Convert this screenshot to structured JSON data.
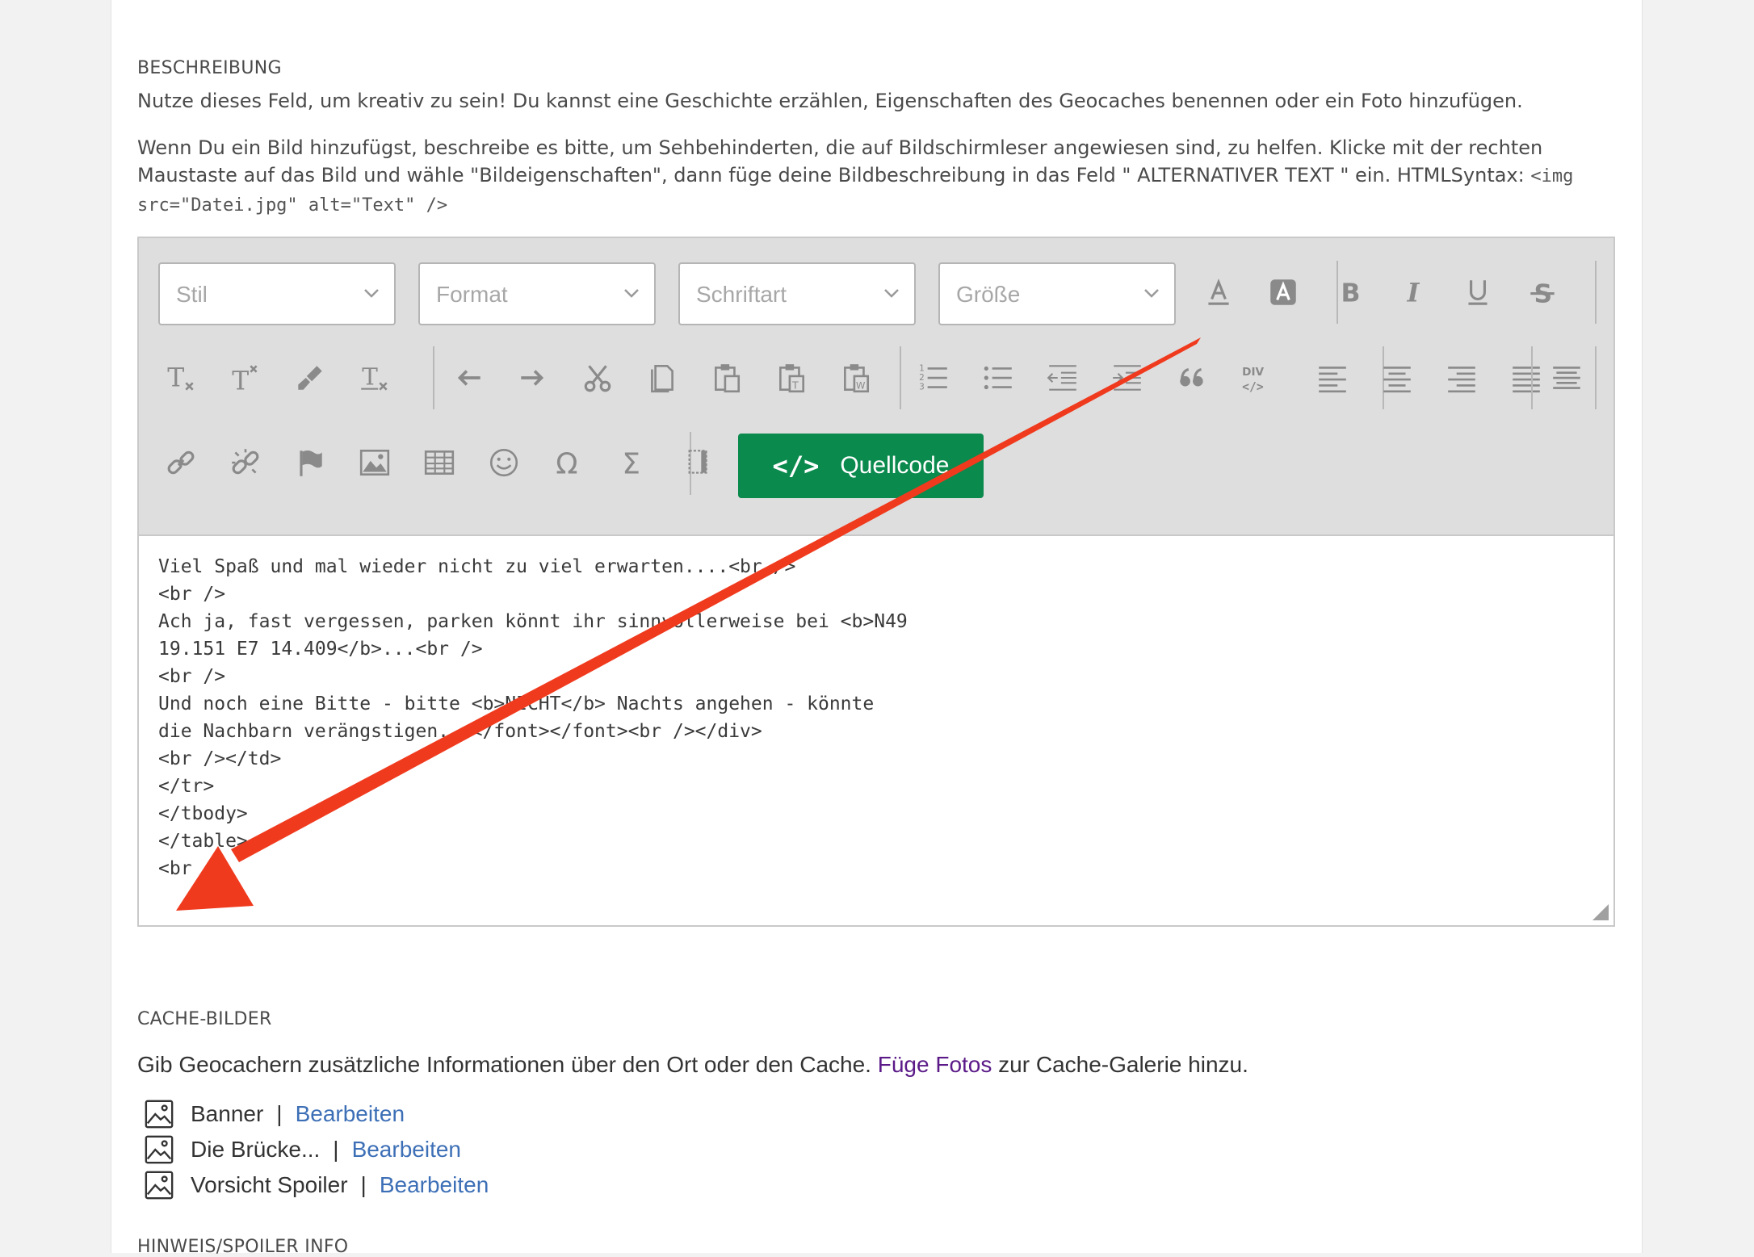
{
  "description_section": {
    "label": "BESCHREIBUNG",
    "intro": "Nutze dieses Feld, um kreativ zu sein! Du kannst eine Geschichte erzählen, Eigenschaften des Geocaches benennen oder ein Foto hinzufügen.",
    "hint_text": "Wenn Du ein Bild hinzufügst, beschreibe es bitte, um Sehbehinderten, die auf Bildschirmleser angewiesen sind, zu helfen. Klicke mit der rechten Maustaste auf das Bild und wähle \"Bildeigenschaften\", dann füge deine Bildbeschreibung in das Feld \" ALTERNATIVER TEXT \" ein. HTMLSyntax: ",
    "hint_code": "<img src=\"Datei.jpg\" alt=\"Text\" />"
  },
  "toolbar": {
    "style_placeholder": "Stil",
    "format_placeholder": "Format",
    "font_placeholder": "Schriftart",
    "size_placeholder": "Größe",
    "source_button_icon": "</>",
    "source_button_label": "Quellcode",
    "source_button_color": "#0a8a4d"
  },
  "editor": {
    "source_lines": [
      "Viel Spaß und mal wieder nicht zu viel erwarten....<br />",
      "<br />",
      "Ach ja, fast vergessen, parken könnt ihr sinnvollerweise bei <b>N49",
      "19.151 E7 14.409</b>...<br />",
      "<br />",
      "Und noch eine Bitte - bitte <b>NICHT</b> Nachts angehen - könnte",
      "die Nachbarn verängstigen...</font></font><br /></div>",
      "<br /></td>",
      "</tr>",
      "</tbody>",
      "</table>",
      "<br />"
    ]
  },
  "cache_images": {
    "label": "CACHE-BILDER",
    "text_before": "Gib Geocachern zusätzliche Informationen über den Ort oder den Cache. ",
    "link_text": "Füge Fotos",
    "text_after": " zur Cache-Galerie hinzu.",
    "separator": "|",
    "items": [
      {
        "name": "Banner",
        "action": "Bearbeiten"
      },
      {
        "name": "Die Brücke...",
        "action": "Bearbeiten"
      },
      {
        "name": "Vorsicht Spoiler",
        "action": "Bearbeiten"
      }
    ]
  },
  "next_section": {
    "label": "HINWEIS/SPOILER INFO"
  },
  "annotation_color": "#f03a1e"
}
